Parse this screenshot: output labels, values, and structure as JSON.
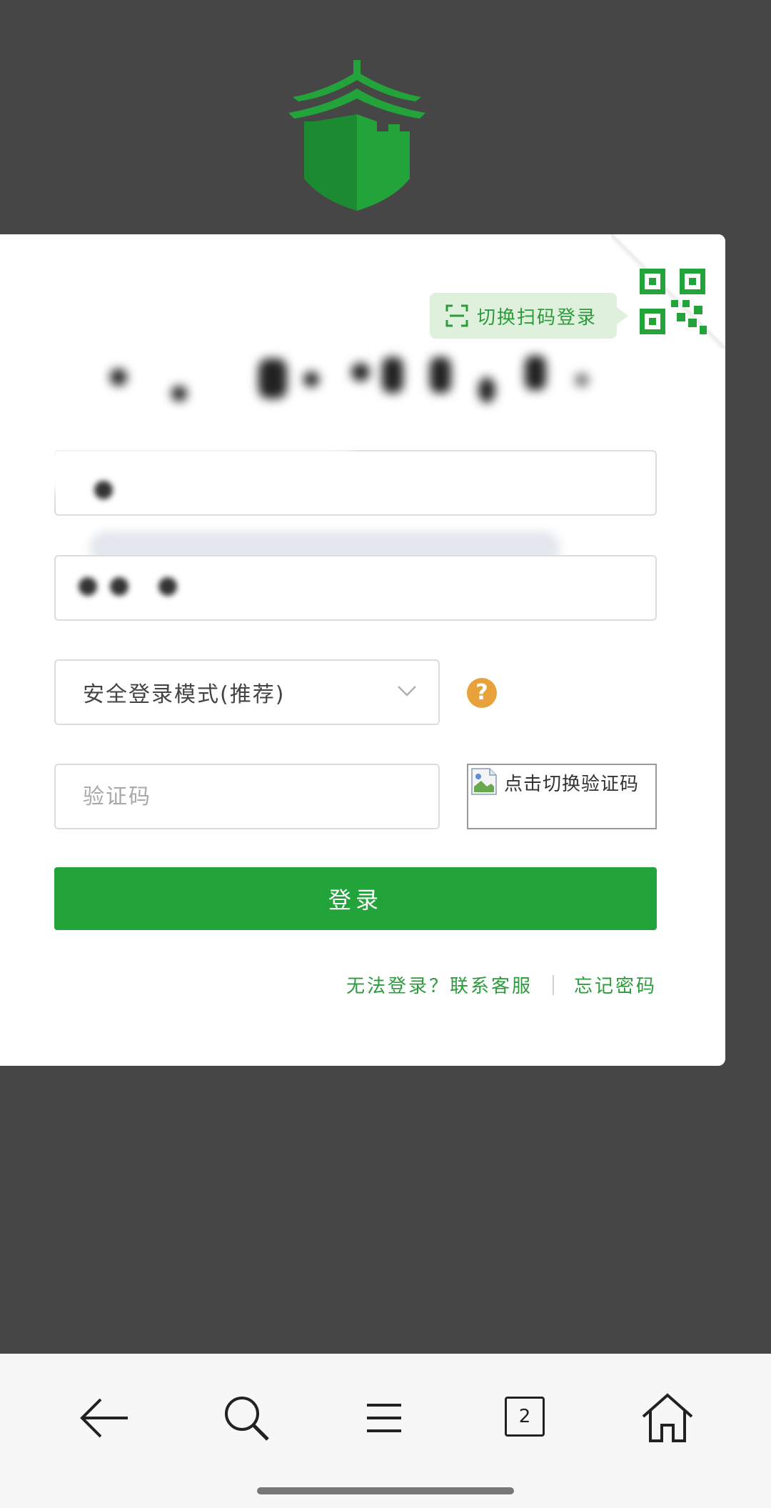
{
  "brand": {
    "accent": "#22a43b",
    "accent_dark": "#1b8a31",
    "link_color": "#2c9b3c",
    "help_color": "#e8a23b",
    "background": "#464646"
  },
  "qr_login": {
    "tip_label": "切换扫码登录",
    "icon": "qr-code-icon"
  },
  "form": {
    "login_mode": {
      "selected": "安全登录模式(推荐)"
    },
    "captcha": {
      "placeholder": "验证码",
      "image_alt": "点击切换验证码"
    },
    "submit_label": "登录"
  },
  "links": {
    "help": "无法登录？联系客服",
    "forgot": "忘记密码"
  },
  "bottom_nav": {
    "items": [
      {
        "icon": "back-arrow-icon"
      },
      {
        "icon": "search-icon"
      },
      {
        "icon": "menu-icon"
      },
      {
        "icon": "tabs-icon",
        "count": "2"
      },
      {
        "icon": "home-icon"
      }
    ]
  }
}
